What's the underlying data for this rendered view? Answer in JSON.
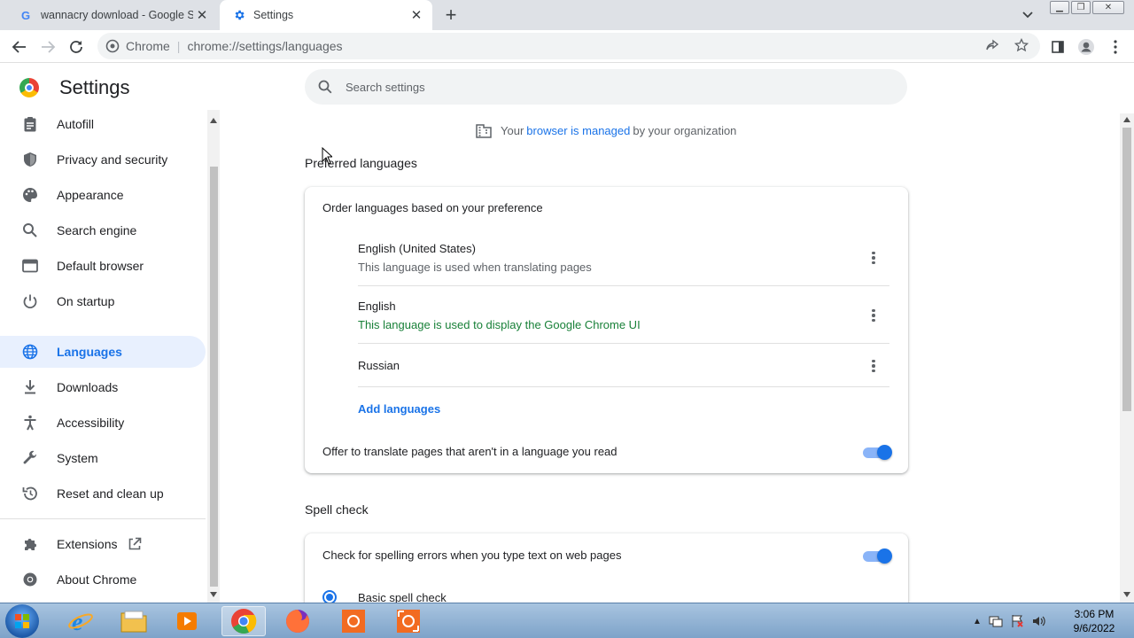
{
  "tabs": [
    {
      "title": "wannacry download - Google Se",
      "active": false
    },
    {
      "title": "Settings",
      "active": true
    }
  ],
  "toolbar": {
    "site": "Chrome",
    "url": "chrome://settings/languages"
  },
  "settings": {
    "title": "Settings",
    "search_placeholder": "Search settings"
  },
  "sidebar": {
    "items": [
      {
        "label": "Autofill",
        "icon": "autofill-icon"
      },
      {
        "label": "Privacy and security",
        "icon": "shield-icon"
      },
      {
        "label": "Appearance",
        "icon": "palette-icon"
      },
      {
        "label": "Search engine",
        "icon": "search-icon"
      },
      {
        "label": "Default browser",
        "icon": "browser-icon"
      },
      {
        "label": "On startup",
        "icon": "power-icon"
      },
      {
        "label": "Languages",
        "icon": "globe-icon",
        "selected": true
      },
      {
        "label": "Downloads",
        "icon": "download-icon"
      },
      {
        "label": "Accessibility",
        "icon": "accessibility-icon"
      },
      {
        "label": "System",
        "icon": "wrench-icon"
      },
      {
        "label": "Reset and clean up",
        "icon": "restore-icon"
      },
      {
        "label": "Extensions",
        "icon": "puzzle-icon"
      },
      {
        "label": "About Chrome",
        "icon": "chrome-icon"
      }
    ]
  },
  "managed": {
    "prefix": "Your",
    "link": "browser is managed",
    "suffix": "by your organization"
  },
  "preferred": {
    "heading": "Preferred languages",
    "order_label": "Order languages based on your preference",
    "languages": [
      {
        "name": "English (United States)",
        "note": "This language is used when translating pages"
      },
      {
        "name": "English",
        "note": "This language is used to display the Google Chrome UI"
      },
      {
        "name": "Russian",
        "note": ""
      }
    ],
    "add_label": "Add languages",
    "offer_translate": "Offer to translate pages that aren't in a language you read",
    "offer_translate_on": true
  },
  "spell": {
    "heading": "Spell check",
    "check_label": "Check for spelling errors when you type text on web pages",
    "check_on": true,
    "basic_label": "Basic spell check"
  },
  "taskbar": {
    "time": "3:06 PM",
    "date": "9/6/2022"
  },
  "colors": {
    "accent": "#1a73e8",
    "selected_bg": "#e8f0fe",
    "green_note": "#188038"
  }
}
